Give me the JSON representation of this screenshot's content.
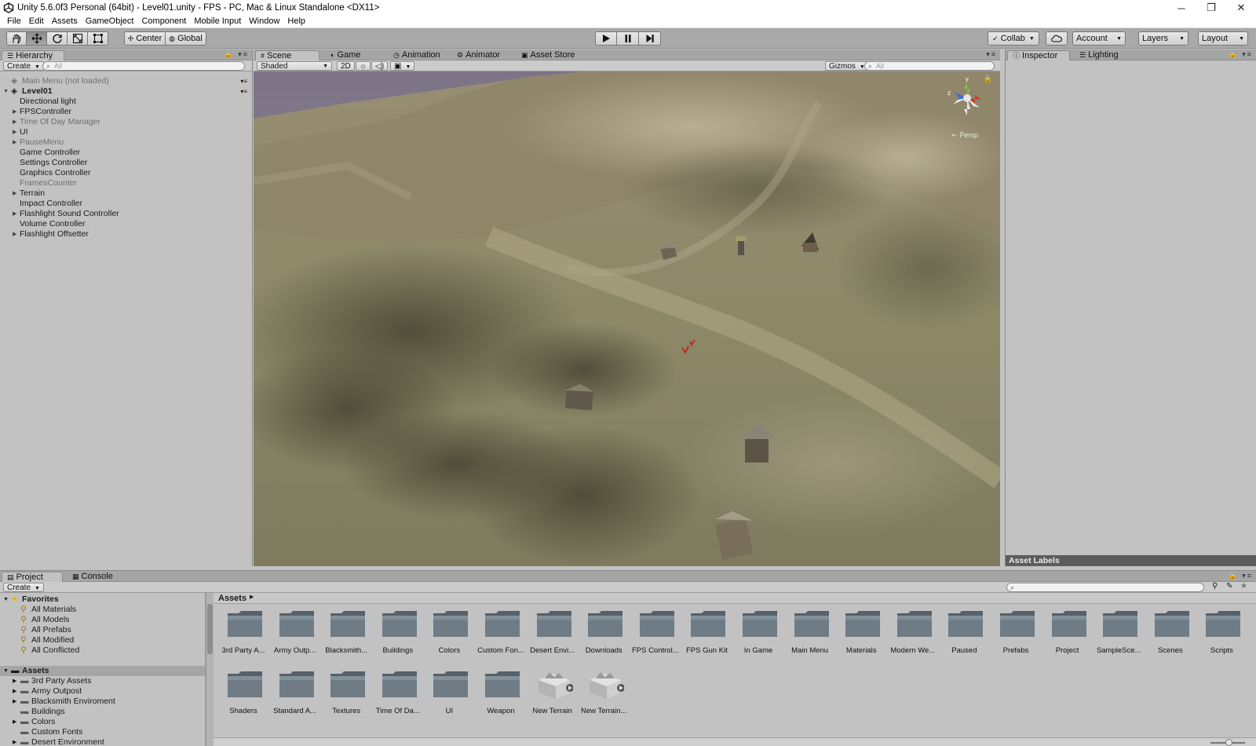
{
  "window": {
    "title": "Unity 5.6.0f3 Personal (64bit) - Level01.unity - FPS - PC, Mac & Linux Standalone <DX11>",
    "controls": [
      "─",
      "❐",
      "✕"
    ]
  },
  "menu": [
    "File",
    "Edit",
    "Assets",
    "GameObject",
    "Component",
    "Mobile Input",
    "Window",
    "Help"
  ],
  "toolbar": {
    "pivot": "Center",
    "space": "Global",
    "collab": "Collab",
    "account": "Account",
    "layers": "Layers",
    "layout": "Layout"
  },
  "hierarchy": {
    "tab": "Hierarchy",
    "create": "Create",
    "search_placeholder": "All",
    "scenes": [
      {
        "name": "Main Menu (not loaded)"
      },
      {
        "name": "Level01"
      }
    ],
    "items": [
      {
        "label": "Directional light",
        "has_children": false,
        "dim": false
      },
      {
        "label": "FPSController",
        "has_children": true,
        "dim": false
      },
      {
        "label": "Time Of Day Manager",
        "has_children": true,
        "dim": true
      },
      {
        "label": "UI",
        "has_children": true,
        "dim": false
      },
      {
        "label": "PauseMenu",
        "has_children": true,
        "dim": true
      },
      {
        "label": "Game Controller",
        "has_children": false,
        "dim": false
      },
      {
        "label": "Settings Controller",
        "has_children": false,
        "dim": false
      },
      {
        "label": "Graphics Controller",
        "has_children": false,
        "dim": false
      },
      {
        "label": "FramesCounter",
        "has_children": false,
        "dim": true
      },
      {
        "label": "Terrain",
        "has_children": true,
        "dim": false
      },
      {
        "label": "Impact Controller",
        "has_children": false,
        "dim": false
      },
      {
        "label": "Flashlight Sound Controller",
        "has_children": true,
        "dim": false
      },
      {
        "label": "Volume Controller",
        "has_children": false,
        "dim": false
      },
      {
        "label": "Flashlight Offsetter",
        "has_children": true,
        "dim": false
      }
    ]
  },
  "center_tabs": [
    {
      "label": "Scene",
      "icon": "#"
    },
    {
      "label": "Game",
      "icon": "◐"
    },
    {
      "label": "Animation",
      "icon": "◷"
    },
    {
      "label": "Animator",
      "icon": "⚙"
    },
    {
      "label": "Asset Store",
      "icon": "▣"
    }
  ],
  "scene_toolbar": {
    "shading": "Shaded",
    "mode_2d": "2D",
    "gizmos": "Gizmos",
    "search_placeholder": "All",
    "projection": "Persp",
    "axes": {
      "y": "y",
      "z": "z"
    }
  },
  "right_tabs": [
    {
      "label": "Inspector",
      "icon": "ⓘ"
    },
    {
      "label": "Lighting",
      "icon": "☰"
    }
  ],
  "inspector": {
    "asset_labels": "Asset Labels"
  },
  "project": {
    "tabs": [
      {
        "label": "Project",
        "icon": "▤"
      },
      {
        "label": "Console",
        "icon": "▦"
      }
    ],
    "create": "Create",
    "favorites_header": "Favorites",
    "favorites": [
      "All Materials",
      "All Models",
      "All Prefabs",
      "All Modified",
      "All Conflicted"
    ],
    "assets_header": "Assets",
    "asset_tree": [
      {
        "label": "3rd Party Assets",
        "has_children": true
      },
      {
        "label": "Army Outpost",
        "has_children": true
      },
      {
        "label": "Blacksmith Enviroment",
        "has_children": true
      },
      {
        "label": "Buildings",
        "has_children": false
      },
      {
        "label": "Colors",
        "has_children": true
      },
      {
        "label": "Custom Fonts",
        "has_children": false
      },
      {
        "label": "Desert Environment",
        "has_children": true
      }
    ],
    "breadcrumb": "Assets",
    "grid": [
      {
        "name": "3rd Party A...",
        "kind": "folder"
      },
      {
        "name": "Army Outp...",
        "kind": "folder"
      },
      {
        "name": "Blacksmith...",
        "kind": "folder"
      },
      {
        "name": "Buildings",
        "kind": "folder"
      },
      {
        "name": "Colors",
        "kind": "folder"
      },
      {
        "name": "Custom Fon...",
        "kind": "folder"
      },
      {
        "name": "Desert Envi...",
        "kind": "folder"
      },
      {
        "name": "Downloads",
        "kind": "folder"
      },
      {
        "name": "FPS Control...",
        "kind": "folder"
      },
      {
        "name": "FPS Gun Kit",
        "kind": "folder"
      },
      {
        "name": "In Game",
        "kind": "folder"
      },
      {
        "name": "Main Menu",
        "kind": "folder"
      },
      {
        "name": "Materials",
        "kind": "folder"
      },
      {
        "name": "Modern We...",
        "kind": "folder"
      },
      {
        "name": "Paused",
        "kind": "folder"
      },
      {
        "name": "Prefabs",
        "kind": "folder"
      },
      {
        "name": "Project",
        "kind": "folder"
      },
      {
        "name": "SampleSce...",
        "kind": "folder"
      },
      {
        "name": "Scenes",
        "kind": "folder"
      },
      {
        "name": "Scripts",
        "kind": "folder"
      },
      {
        "name": "Shaders",
        "kind": "folder"
      },
      {
        "name": "Standard A...",
        "kind": "folder"
      },
      {
        "name": "Textures",
        "kind": "folder"
      },
      {
        "name": "Time Of Da...",
        "kind": "folder"
      },
      {
        "name": "UI",
        "kind": "folder"
      },
      {
        "name": "Weapon",
        "kind": "folder"
      },
      {
        "name": "New Terrain",
        "kind": "terrain"
      },
      {
        "name": "New Terrain...",
        "kind": "terrain"
      }
    ]
  }
}
